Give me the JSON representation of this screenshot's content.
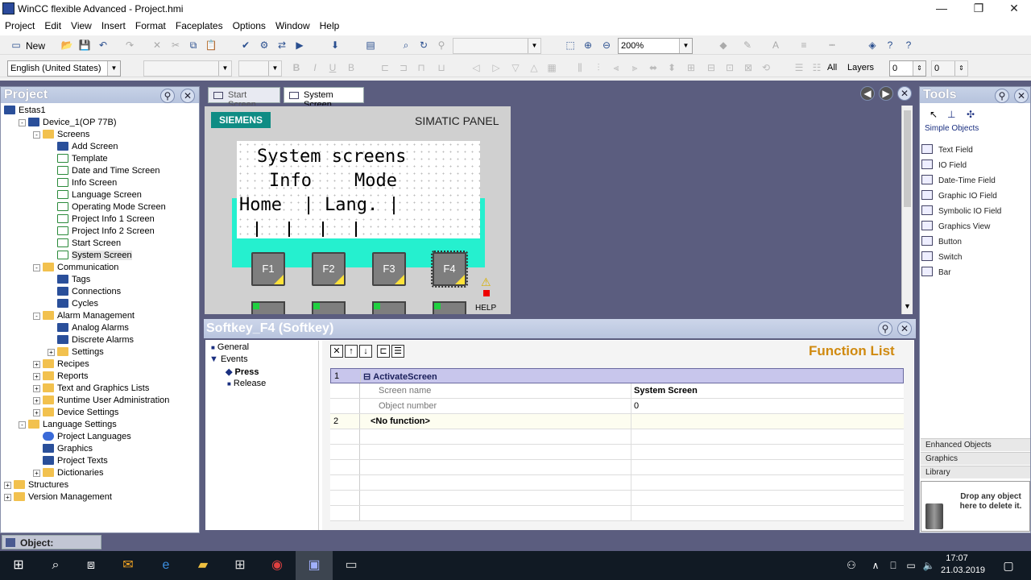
{
  "window": {
    "title": "WinCC flexible Advanced - Project.hmi",
    "min": "—",
    "max": "❐",
    "close": "✕"
  },
  "menu": [
    "Project",
    "Edit",
    "View",
    "Insert",
    "Format",
    "Faceplates",
    "Options",
    "Window",
    "Help"
  ],
  "toolbar": {
    "new_label": "New",
    "zoom_value": "200%",
    "language_value": "English (United States)",
    "all_label": "All",
    "layers_label": "Layers",
    "layer_value_1": "0",
    "layer_value_2": "0"
  },
  "project_panel": {
    "title": "Project",
    "tree": [
      {
        "label": "Estas1",
        "level": 0,
        "icon": "project-icon"
      },
      {
        "label": "Device_1(OP 77B)",
        "level": 1,
        "icon": "device-icon",
        "exp": "-"
      },
      {
        "label": "Screens",
        "level": 2,
        "icon": "folder-icon",
        "exp": "-"
      },
      {
        "label": "Add Screen",
        "level": 3,
        "icon": "add-screen-icon"
      },
      {
        "label": "Template",
        "level": 3,
        "icon": "screen-icon"
      },
      {
        "label": "Date and Time Screen",
        "level": 3,
        "icon": "screen-icon"
      },
      {
        "label": "Info Screen",
        "level": 3,
        "icon": "screen-icon"
      },
      {
        "label": "Language Screen",
        "level": 3,
        "icon": "screen-icon"
      },
      {
        "label": "Operating Mode Screen",
        "level": 3,
        "icon": "screen-icon"
      },
      {
        "label": "Project Info 1 Screen",
        "level": 3,
        "icon": "screen-icon"
      },
      {
        "label": "Project Info 2 Screen",
        "level": 3,
        "icon": "screen-icon"
      },
      {
        "label": "Start Screen",
        "level": 3,
        "icon": "screen-icon"
      },
      {
        "label": "System Screen",
        "level": 3,
        "icon": "screen-icon",
        "selected": true
      },
      {
        "label": "Communication",
        "level": 2,
        "icon": "folder-icon",
        "exp": "-"
      },
      {
        "label": "Tags",
        "level": 3,
        "icon": "tags-icon"
      },
      {
        "label": "Connections",
        "level": 3,
        "icon": "connections-icon"
      },
      {
        "label": "Cycles",
        "level": 3,
        "icon": "cycles-icon"
      },
      {
        "label": "Alarm Management",
        "level": 2,
        "icon": "folder-icon",
        "exp": "-"
      },
      {
        "label": "Analog Alarms",
        "level": 3,
        "icon": "alarm-icon"
      },
      {
        "label": "Discrete Alarms",
        "level": 3,
        "icon": "alarm-icon"
      },
      {
        "label": "Settings",
        "level": 3,
        "icon": "folder-icon",
        "exp": "+"
      },
      {
        "label": "Recipes",
        "level": 2,
        "icon": "folder-icon",
        "exp": "+"
      },
      {
        "label": "Reports",
        "level": 2,
        "icon": "folder-icon",
        "exp": "+"
      },
      {
        "label": "Text and Graphics Lists",
        "level": 2,
        "icon": "folder-icon",
        "exp": "+"
      },
      {
        "label": "Runtime User Administration",
        "level": 2,
        "icon": "folder-icon",
        "exp": "+"
      },
      {
        "label": "Device Settings",
        "level": 2,
        "icon": "folder-icon",
        "exp": "+"
      },
      {
        "label": "Language Settings",
        "level": 1,
        "icon": "folder-icon",
        "exp": "-"
      },
      {
        "label": "Project Languages",
        "level": 2,
        "icon": "globe-icon"
      },
      {
        "label": "Graphics",
        "level": 2,
        "icon": "graphics-icon"
      },
      {
        "label": "Project Texts",
        "level": 2,
        "icon": "texts-icon"
      },
      {
        "label": "Dictionaries",
        "level": 2,
        "icon": "folder-icon",
        "exp": "+"
      },
      {
        "label": "Structures",
        "level": 0,
        "icon": "folder-icon",
        "exp": "+"
      },
      {
        "label": "Version Management",
        "level": 0,
        "icon": "folder-icon",
        "exp": "+"
      }
    ]
  },
  "editor": {
    "tabs": [
      {
        "label": "Start Screen",
        "active": false
      },
      {
        "label": "System Screen",
        "active": true
      }
    ],
    "panel_brand": "SIEMENS",
    "panel_name": "SIMATIC PANEL",
    "screen_lines": [
      "System screens",
      "Info    Mode",
      "Home  | Lang. |"
    ],
    "fkeys": [
      "F1",
      "F2",
      "F3",
      "F4"
    ],
    "help_label": "HELP"
  },
  "properties": {
    "title": "Softkey_F4 (Softkey)",
    "tree": [
      {
        "label": "General",
        "level": 0
      },
      {
        "label": "Events",
        "level": 0,
        "expanded": true
      },
      {
        "label": "Press",
        "level": 1,
        "selected": true
      },
      {
        "label": "Release",
        "level": 1
      }
    ],
    "function_list_title": "Function List",
    "rows": [
      {
        "num": "1",
        "c2": "ActivateScreen",
        "c3": "",
        "type": "function"
      },
      {
        "num": "",
        "c2": "Screen name",
        "c3": "System Screen",
        "type": "param"
      },
      {
        "num": "",
        "c2": "Object number",
        "c3": "0",
        "type": "param"
      },
      {
        "num": "2",
        "c2": "<No function>",
        "c3": "",
        "type": "empty"
      }
    ]
  },
  "tools": {
    "title": "Tools",
    "section": "Simple Objects",
    "items": [
      "Text Field",
      "IO Field",
      "Date-Time Field",
      "Graphic IO Field",
      "Symbolic IO Field",
      "Graphics View",
      "Button",
      "Switch",
      "Bar"
    ],
    "bottom_sections": [
      "Enhanced Objects",
      "Graphics",
      "Library"
    ],
    "drop_hint": "Drop any object here to delete it."
  },
  "status": {
    "object_label": "Object:"
  },
  "taskbar": {
    "time": "17:07",
    "date": "21.03.2019"
  },
  "colors": {
    "panel_bg": "#5b5d7f",
    "teal": "#25f0cf",
    "siemens": "#0f8c84",
    "function_list": "#d08a10",
    "selection": "#c8c6ec"
  }
}
